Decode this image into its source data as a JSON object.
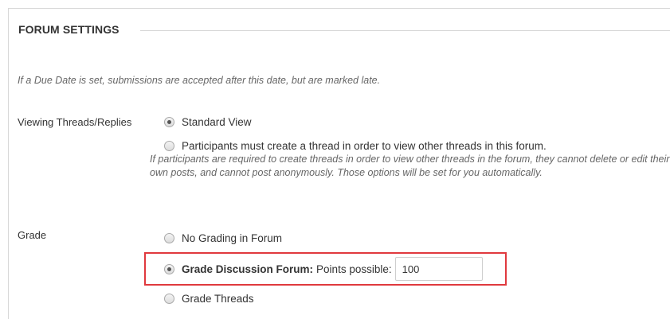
{
  "section": {
    "title": "FORUM SETTINGS"
  },
  "due_date_note": "If a Due Date is set, submissions are accepted after this date, but are marked late.",
  "viewing": {
    "label": "Viewing Threads/Replies",
    "options": [
      {
        "label": "Standard View",
        "checked": true
      },
      {
        "label": "Participants must create a thread in order to view other threads in this forum.",
        "checked": false
      }
    ],
    "description": "If participants are required to create threads in order to view other threads in the forum, they cannot delete or edit their own posts, and cannot post anonymously. Those options will be set for you automatically."
  },
  "grade": {
    "label": "Grade",
    "options": [
      {
        "label": "No Grading in Forum",
        "checked": false
      },
      {
        "label": "Grade Discussion Forum:",
        "sublabel": "Points possible:",
        "checked": true
      },
      {
        "label": "Grade Threads",
        "checked": false
      }
    ],
    "points_value": "100"
  },
  "colors": {
    "highlight": "#e0393e",
    "rule": "#d7d7d7",
    "note_text": "#666666"
  }
}
